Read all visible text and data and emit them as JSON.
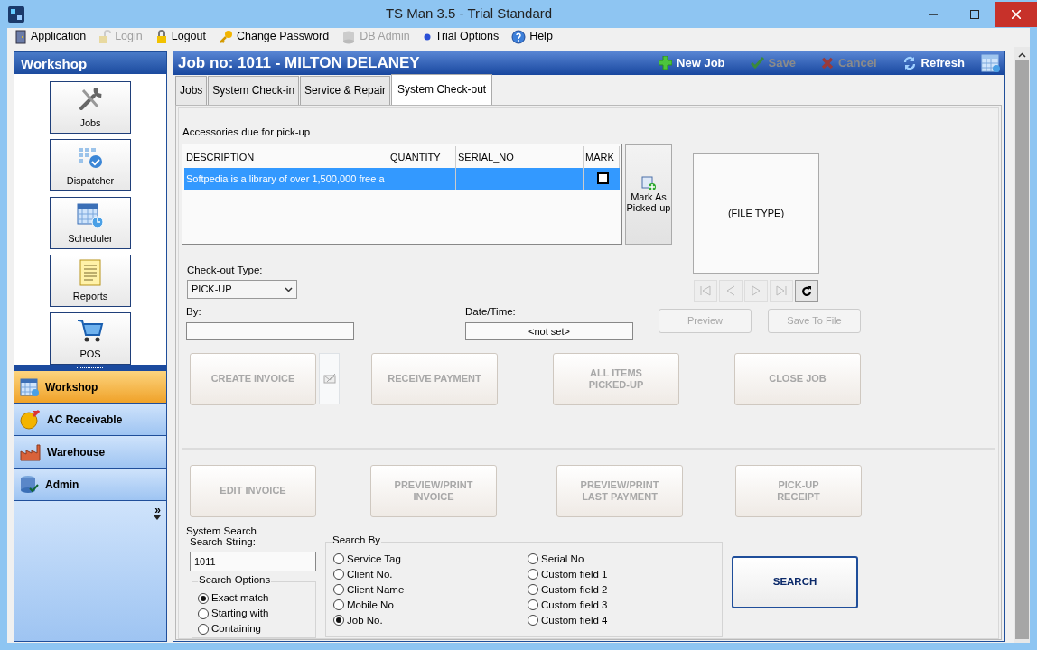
{
  "window": {
    "title": "TS Man 3.5 - Trial Standard"
  },
  "menu": [
    {
      "label": "Application",
      "disabled": false
    },
    {
      "label": "Login",
      "disabled": true
    },
    {
      "label": "Logout",
      "disabled": false
    },
    {
      "label": "Change Password",
      "disabled": false
    },
    {
      "label": "DB Admin",
      "disabled": true
    },
    {
      "label": "Trial Options",
      "disabled": false
    },
    {
      "label": "Help",
      "disabled": false
    }
  ],
  "sidebar": {
    "title": "Workshop",
    "tiles": [
      "Jobs",
      "Dispatcher",
      "Scheduler",
      "Reports",
      "POS"
    ],
    "modules": [
      {
        "label": "Workshop",
        "selected": true
      },
      {
        "label": "AC Receivable",
        "selected": false
      },
      {
        "label": "Warehouse",
        "selected": false
      },
      {
        "label": "Admin",
        "selected": false
      }
    ],
    "more": "»"
  },
  "job_header": {
    "title": "Job no: 1011 - MILTON DELANEY",
    "actions": [
      {
        "label": "New Job",
        "disabled": false
      },
      {
        "label": "Save",
        "disabled": true
      },
      {
        "label": "Cancel",
        "disabled": true
      },
      {
        "label": "Refresh",
        "disabled": false
      }
    ]
  },
  "tabs": [
    {
      "label": "Jobs",
      "selected": false
    },
    {
      "label": "System Check-in",
      "selected": false
    },
    {
      "label": "Service & Repair",
      "selected": false
    },
    {
      "label": "System Check-out",
      "selected": true
    }
  ],
  "accessories": {
    "label": "Accessories due for pick-up",
    "columns": [
      "DESCRIPTION",
      "QUANTITY",
      "SERIAL_NO",
      "MARK"
    ],
    "rows": [
      {
        "description": "Softpedia is a library of over 1,500,000 free a",
        "mark": false,
        "selected": true
      }
    ]
  },
  "mark_button": "Mark As\nPicked-up",
  "checkout_type": {
    "label": "Check-out Type:",
    "value": "PICK-UP"
  },
  "by": {
    "label": "By:"
  },
  "datetime": {
    "label": "Date/Time:",
    "value": "<not set>"
  },
  "preview": {
    "text": "(FILE TYPE)"
  },
  "preview_buttons": [
    {
      "label": "Preview",
      "disabled": true
    },
    {
      "label": "Save To File",
      "disabled": true
    }
  ],
  "actions_row1": [
    {
      "label": "CREATE INVOICE",
      "disabled": true
    },
    {
      "label": "RECEIVE PAYMENT",
      "disabled": true
    },
    {
      "label": "ALL ITEMS\nPICKED-UP",
      "disabled": true
    },
    {
      "label": "CLOSE JOB",
      "disabled": true
    }
  ],
  "actions_row2": [
    {
      "label": "EDIT INVOICE",
      "disabled": true
    },
    {
      "label": "PREVIEW/PRINT\nINVOICE",
      "disabled": true
    },
    {
      "label": "PREVIEW/PRINT\nLAST PAYMENT",
      "disabled": true
    },
    {
      "label": "PICK-UP\nRECEIPT",
      "disabled": true
    }
  ],
  "search": {
    "title": "System Search",
    "string_label": "Search String:",
    "string_value": "1011",
    "options_title": "Search Options",
    "options": [
      {
        "label": "Exact match",
        "selected": true
      },
      {
        "label": "Starting with",
        "selected": false
      },
      {
        "label": "Containing",
        "selected": false
      }
    ],
    "by_title": "Search By",
    "by": [
      {
        "label": "Service Tag",
        "selected": false
      },
      {
        "label": "Client No.",
        "selected": false
      },
      {
        "label": "Client Name",
        "selected": false
      },
      {
        "label": "Mobile No",
        "selected": false
      },
      {
        "label": "Job No.",
        "selected": true
      },
      {
        "label": "Serial No",
        "selected": false
      },
      {
        "label": "Custom field 1",
        "selected": false
      },
      {
        "label": "Custom field 2",
        "selected": false
      },
      {
        "label": "Custom field 3",
        "selected": false
      },
      {
        "label": "Custom field 4",
        "selected": false
      }
    ],
    "button": "SEARCH"
  }
}
